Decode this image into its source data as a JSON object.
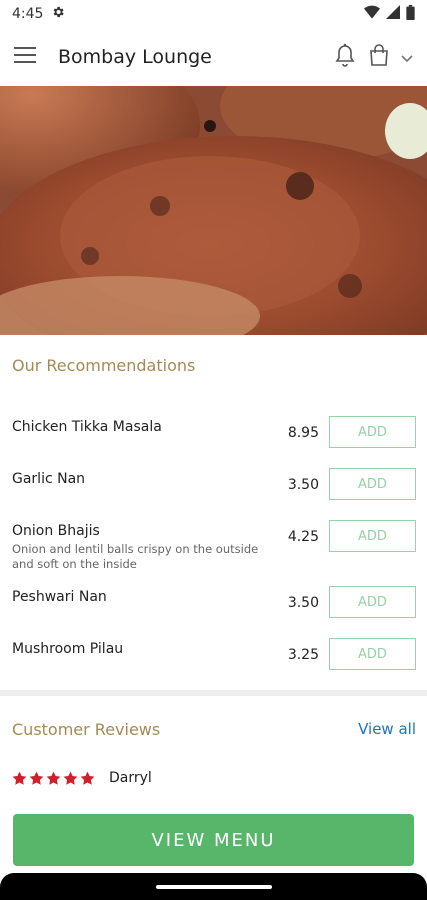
{
  "status_bar": {
    "time": "4:45"
  },
  "header": {
    "title": "Bombay Lounge"
  },
  "recommendations": {
    "title": "Our Recommendations",
    "items": [
      {
        "name": "Chicken Tikka Masala",
        "description": "",
        "price": "8.95",
        "add_label": "ADD"
      },
      {
        "name": "Garlic Nan",
        "description": "",
        "price": "3.50",
        "add_label": "ADD"
      },
      {
        "name": "Onion Bhajis",
        "description": "Onion and lentil balls crispy on the outside and soft on the inside",
        "price": "4.25",
        "add_label": "ADD"
      },
      {
        "name": "Peshwari Nan",
        "description": "",
        "price": "3.50",
        "add_label": "ADD"
      },
      {
        "name": "Mushroom Pilau",
        "description": "",
        "price": "3.25",
        "add_label": "ADD"
      }
    ]
  },
  "reviews": {
    "title": "Customer Reviews",
    "view_all": "View all",
    "items": [
      {
        "name": "Darryl",
        "rating": 5
      }
    ]
  },
  "view_menu": {
    "label": "VIEW MENU"
  },
  "colors": {
    "accent_gold": "#a38b53",
    "green": "#58b66a",
    "add_border": "#96d3a6",
    "link_blue": "#1b73c1",
    "star_red": "#d0202a"
  }
}
